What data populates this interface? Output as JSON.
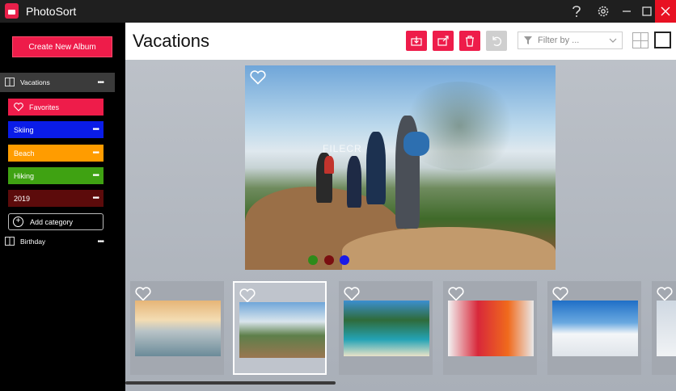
{
  "app": {
    "title": "PhotoSort"
  },
  "window": {
    "help_icon": "question-mark-icon",
    "settings_icon": "gear-icon",
    "minimize_icon": "minimize-icon",
    "maximize_icon": "maximize-icon",
    "close_icon": "close-icon"
  },
  "sidebar": {
    "create_label": "Create New Album",
    "albums": [
      {
        "label": "Vacations",
        "active": true
      },
      {
        "label": "Birthday",
        "active": false
      }
    ],
    "categories": [
      {
        "label": "Favorites",
        "color": "#ee1c4a",
        "more": false,
        "icon": "heart-icon"
      },
      {
        "label": "Skiing",
        "color": "#0a1ce8",
        "more": true
      },
      {
        "label": "Beach",
        "color": "#ff9c00",
        "more": true
      },
      {
        "label": "Hiking",
        "color": "#3fa212",
        "more": true
      },
      {
        "label": "2019",
        "color": "#5c0b0b",
        "more": true
      }
    ],
    "add_category_label": "Add category",
    "more_glyph": "•••"
  },
  "header": {
    "title": "Vacations",
    "filter_placeholder": "Filter by ...",
    "buttons": [
      "import-icon",
      "export-icon",
      "delete-icon",
      "undo-icon"
    ]
  },
  "main_photo": {
    "watermark": "FILECR",
    "dots": [
      "#2e8b1a",
      "#7a0e10",
      "#1a1ae8"
    ]
  },
  "thumbnails": [
    {
      "subject": "beach couple",
      "selected": false
    },
    {
      "subject": "hikers",
      "selected": true
    },
    {
      "subject": "tropical beach",
      "selected": false
    },
    {
      "subject": "snow child",
      "selected": false
    },
    {
      "subject": "snow slope",
      "selected": false
    },
    {
      "subject": "snow",
      "selected": false
    }
  ]
}
